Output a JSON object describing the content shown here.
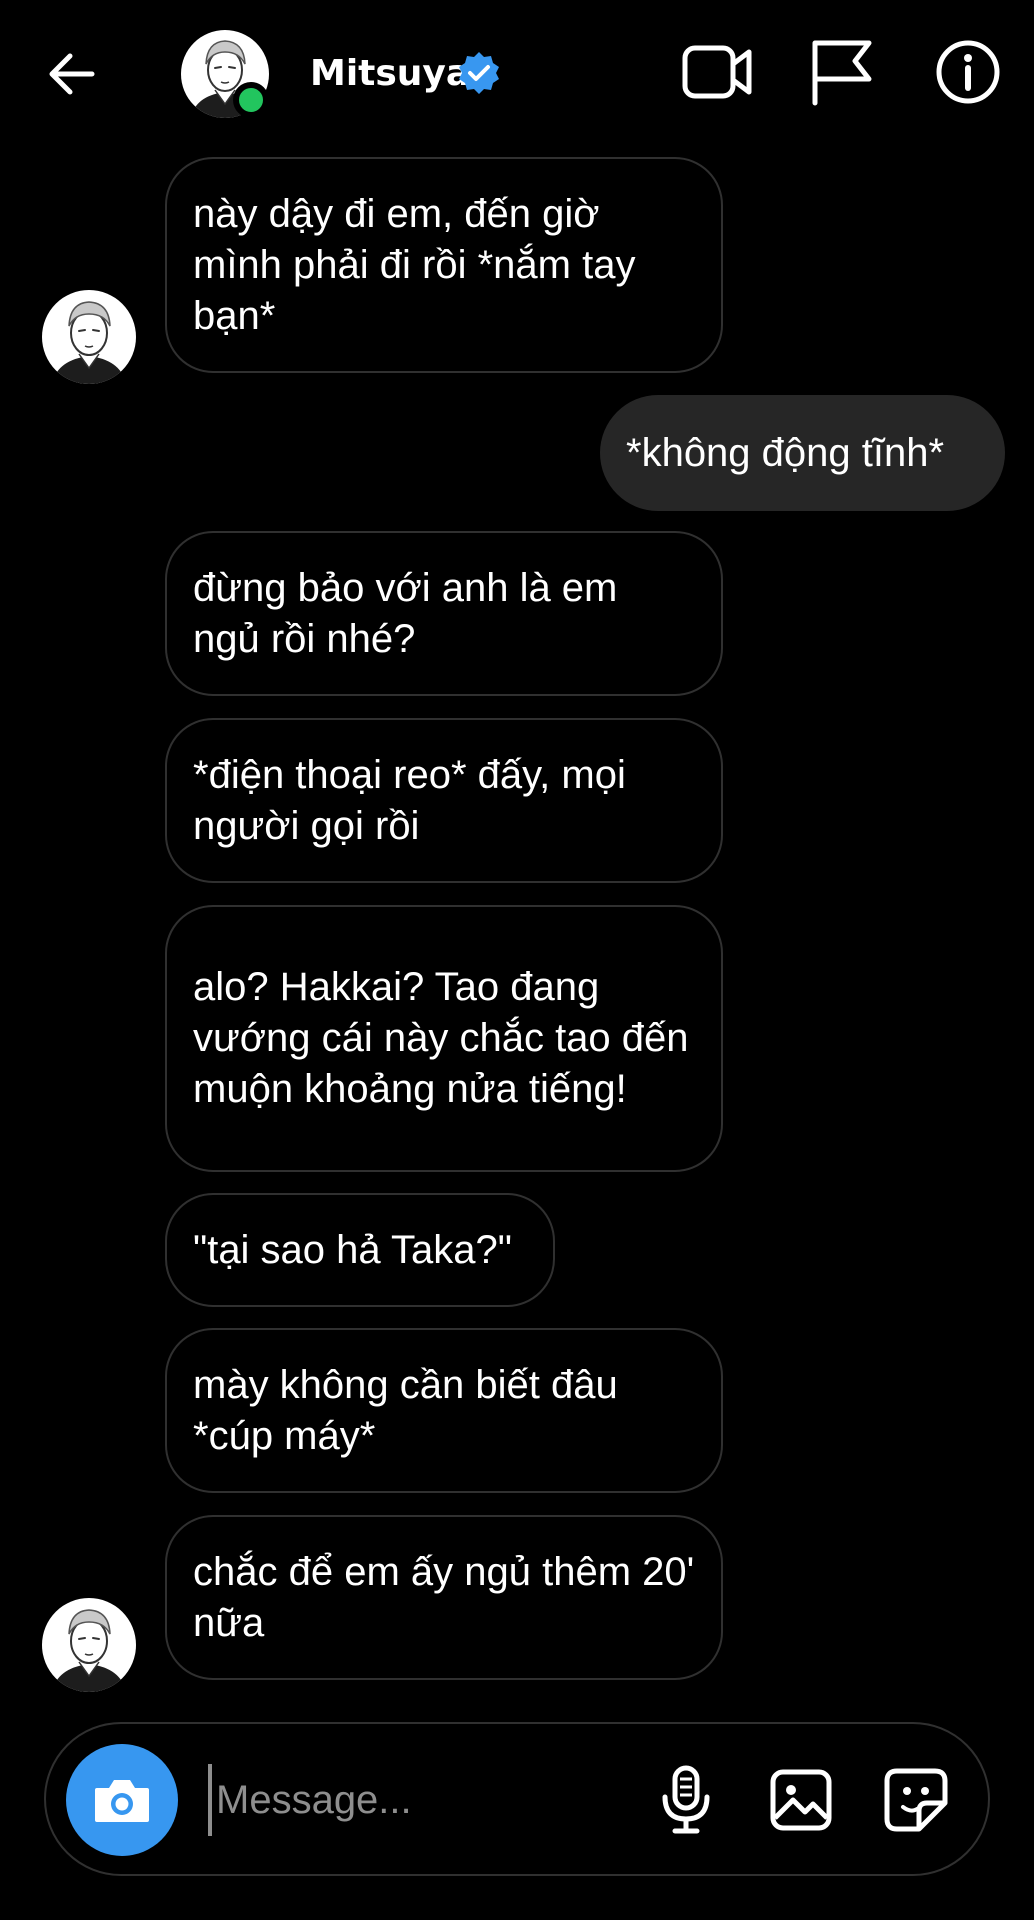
{
  "header": {
    "name": "Mitsuya",
    "icons": {
      "back": "arrow-left-icon",
      "verified": "verified-badge-icon",
      "video": "video-camera-icon",
      "flag": "flag-icon",
      "info": "info-icon"
    }
  },
  "messages": [
    {
      "direction": "incoming",
      "text": "này dậy đi em, đến giờ mình phải đi rồi *nắm tay bạn*"
    },
    {
      "direction": "outgoing",
      "text": "*không động tĩnh*"
    },
    {
      "direction": "incoming",
      "text": "đừng bảo với anh là em ngủ rồi nhé?"
    },
    {
      "direction": "incoming",
      "text": "*điện thoại reo* đấy, mọi người gọi rồi"
    },
    {
      "direction": "incoming",
      "text": "alo? Hakkai? Tao đang vướng cái này chắc tao đến muộn khoảng nửa tiếng!"
    },
    {
      "direction": "incoming",
      "text": "\"tại sao hả Taka?\""
    },
    {
      "direction": "incoming",
      "text": "mày không cần biết đâu *cúp máy*"
    },
    {
      "direction": "incoming",
      "text": "chắc để em ấy ngủ thêm 20' nữa"
    }
  ],
  "composer": {
    "placeholder": "Message...",
    "icons": {
      "camera": "camera-icon",
      "mic": "microphone-icon",
      "gallery": "image-gallery-icon",
      "sticker": "sticker-icon"
    }
  },
  "colors": {
    "background": "#000000",
    "outgoing_bubble": "#262626",
    "incoming_border": "#303030",
    "accent": "#3797f0",
    "online": "#22c55e",
    "verified": "#3897f0"
  }
}
